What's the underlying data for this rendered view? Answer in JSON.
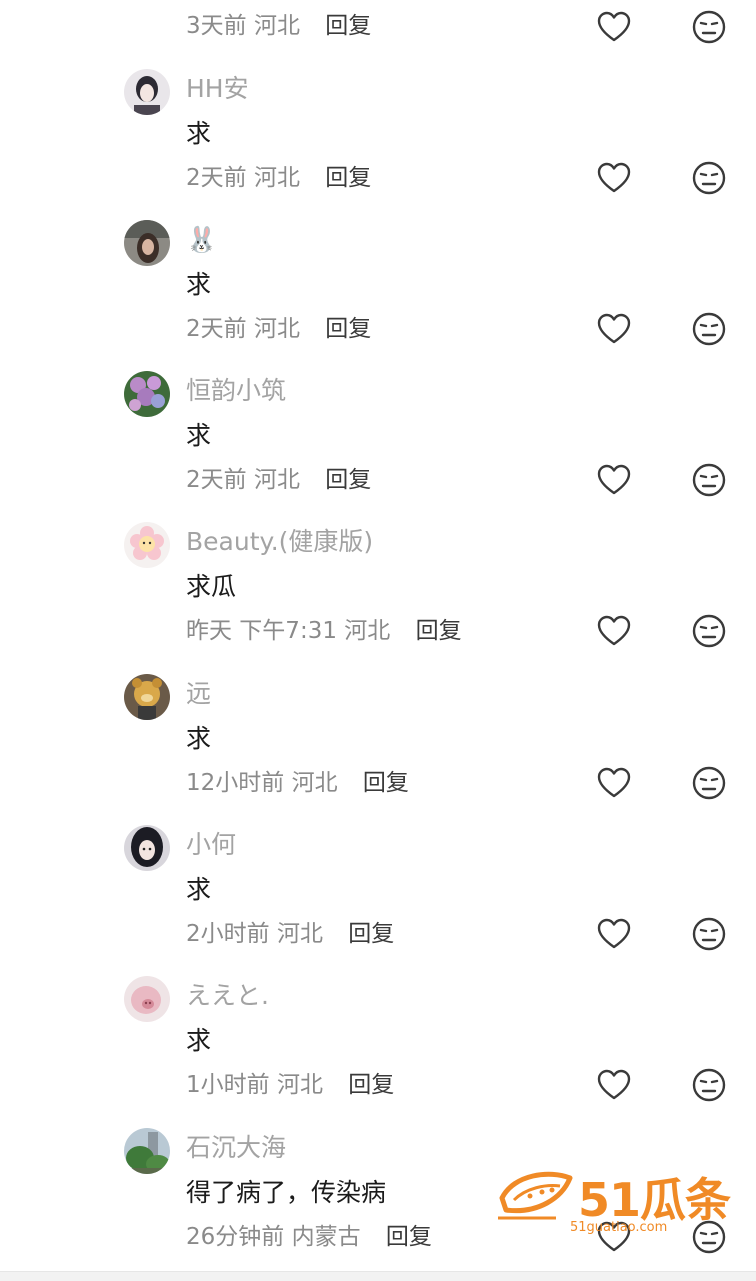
{
  "comments": [
    {
      "username": "",
      "content": "",
      "time": "3天前",
      "location": "河北",
      "reply_label": "回复",
      "avatar": "none"
    },
    {
      "username": "HH安",
      "content": "求",
      "time": "2天前",
      "location": "河北",
      "reply_label": "回复",
      "avatar": "anime-girl"
    },
    {
      "username": "🐰",
      "content": "求",
      "time": "2天前",
      "location": "河北",
      "reply_label": "回复",
      "avatar": "photo-person"
    },
    {
      "username": "恒韵小筑",
      "content": "求",
      "time": "2天前",
      "location": "河北",
      "reply_label": "回复",
      "avatar": "flowers"
    },
    {
      "username": "Beauty.(健康版)",
      "content": "求瓜",
      "time": "昨天 下午7:31",
      "location": "河北",
      "reply_label": "回复",
      "avatar": "pink-flower"
    },
    {
      "username": "远",
      "content": "求",
      "time": "12小时前",
      "location": "河北",
      "reply_label": "回复",
      "avatar": "plush-bear"
    },
    {
      "username": "小何",
      "content": "求",
      "time": "2小时前",
      "location": "河北",
      "reply_label": "回复",
      "avatar": "anime-dark"
    },
    {
      "username": "ええと.",
      "content": "求",
      "time": "1小时前",
      "location": "河北",
      "reply_label": "回复",
      "avatar": "pink-blur"
    },
    {
      "username": "石沉大海",
      "content": "得了病了，传染病",
      "time": "26分钟前",
      "location": "内蒙古",
      "reply_label": "回复",
      "avatar": "tree"
    }
  ],
  "watermark": {
    "brand": "51瓜条",
    "url": "51guatiao.com"
  },
  "colors": {
    "username": "#a3a3a3",
    "content": "#1b1b1b",
    "meta": "#8a8a8a",
    "icon": "#3a3a3a",
    "watermark": "#f08a26"
  }
}
